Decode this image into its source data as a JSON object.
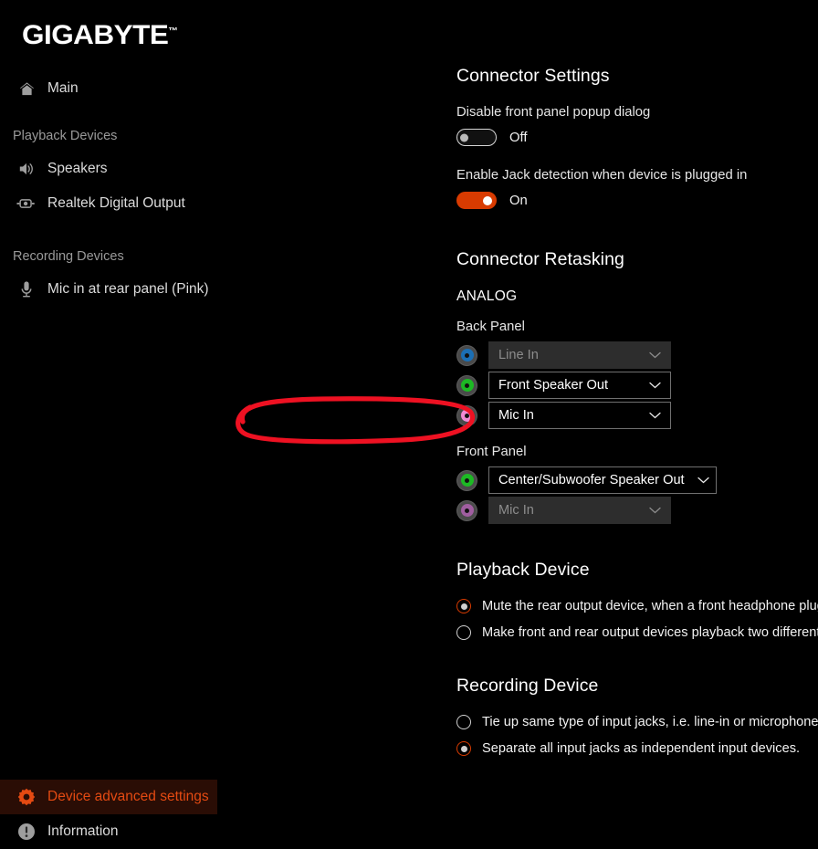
{
  "brand": {
    "name": "GIGABYTE",
    "trademark": "™"
  },
  "sidebar": {
    "main_item": {
      "label": "Main",
      "icon": "home-icon"
    },
    "groups": [
      {
        "title": "Playback Devices",
        "items": [
          {
            "label": "Speakers",
            "icon": "speaker-icon"
          },
          {
            "label": "Realtek Digital Output",
            "icon": "digital-output-icon"
          }
        ]
      },
      {
        "title": "Recording Devices",
        "items": [
          {
            "label": "Mic in at rear panel (Pink)",
            "icon": "microphone-icon"
          }
        ]
      }
    ],
    "bottom_items": [
      {
        "label": "Device advanced settings",
        "icon": "gear-icon",
        "selected": true
      },
      {
        "label": "Information",
        "icon": "info-icon",
        "selected": false
      }
    ],
    "selected_bg": "#2a0d05",
    "selected_fg": "#e44a12"
  },
  "connector_settings": {
    "title": "Connector Settings",
    "toggles": [
      {
        "label": "Disable front panel popup dialog",
        "state": "Off",
        "on": false
      },
      {
        "label": "Enable Jack detection when device is plugged in",
        "state": "On",
        "on": true
      }
    ]
  },
  "connector_retasking": {
    "title": "Connector Retasking",
    "analog_label": "ANALOG",
    "back_panel": {
      "label": "Back Panel",
      "jacks": [
        {
          "value": "Line In",
          "color": "#1b6fb5",
          "enabled": false
        },
        {
          "value": "Front Speaker Out",
          "color": "#1db924",
          "enabled": true
        },
        {
          "value": "Mic In",
          "color": "#ef8ad4",
          "enabled": true,
          "annotated": true
        }
      ]
    },
    "front_panel": {
      "label": "Front Panel",
      "jacks": [
        {
          "value": "Center/Subwoofer Speaker Out",
          "color": "#1db924",
          "enabled": true
        },
        {
          "value": "Mic In",
          "color": "#a05ea0",
          "enabled": false
        }
      ]
    }
  },
  "playback_device": {
    "title": "Playback Device",
    "options": [
      {
        "label": "Mute the rear output device, when a front headphone plugged in.",
        "checked": true
      },
      {
        "label": "Make front and rear output devices playback two different audio streams simultaneously.",
        "checked": false
      }
    ]
  },
  "recording_device": {
    "title": "Recording Device",
    "options": [
      {
        "label": "Tie up same type of input jacks, i.e. line-in or microphone, as an input device.",
        "checked": false
      },
      {
        "label": "Separate all input jacks as independent input devices.",
        "checked": true
      }
    ]
  },
  "annotation": {
    "type": "red-ellipse",
    "color": "#ee1122",
    "target": "back-panel-mic-in-row"
  },
  "colors": {
    "accent": "#d83b01",
    "background": "#000000",
    "disabled_field": "#2d2d2d"
  }
}
